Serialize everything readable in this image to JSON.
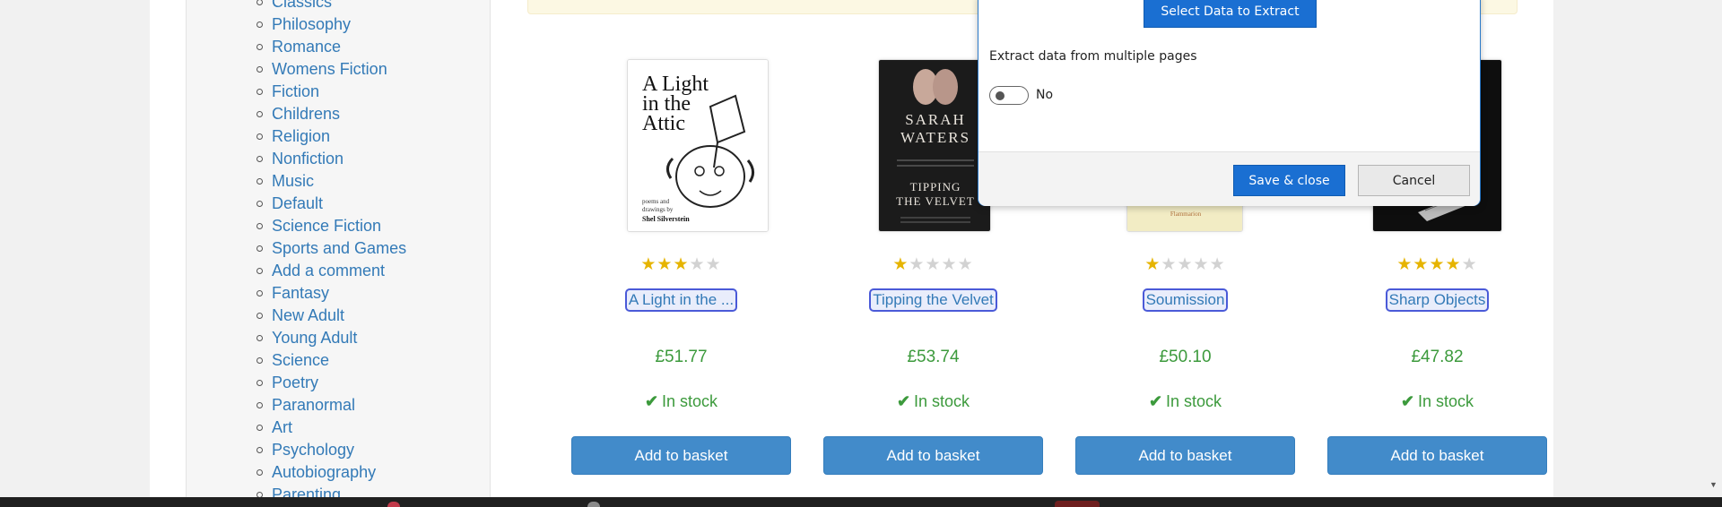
{
  "sidebar": {
    "categories": [
      "Classics",
      "Philosophy",
      "Romance",
      "Womens Fiction",
      "Fiction",
      "Childrens",
      "Religion",
      "Nonfiction",
      "Music",
      "Default",
      "Science Fiction",
      "Sports and Games",
      "Add a comment",
      "Fantasy",
      "New Adult",
      "Young Adult",
      "Science",
      "Poetry",
      "Paranormal",
      "Art",
      "Psychology",
      "Autobiography",
      "Parenting"
    ]
  },
  "products": [
    {
      "title": "A Light in the ...",
      "price": "£51.77",
      "stock": "In stock",
      "button": "Add to basket",
      "rating": 3,
      "cover": {
        "title_lines": [
          "A Light",
          "in the",
          "Attic"
        ],
        "small": [
          "poems and",
          "drawings by"
        ],
        "author": "Shel Silverstein"
      }
    },
    {
      "title": "Tipping the Velvet",
      "price": "£53.74",
      "stock": "In stock",
      "button": "Add to basket",
      "rating": 1,
      "cover": {
        "author_lines": [
          "SARAH",
          "WATERS"
        ],
        "title_lines": [
          "TIPPING",
          "THE VELVET"
        ]
      }
    },
    {
      "title": "Soumission",
      "price": "£50.10",
      "stock": "In stock",
      "button": "Add to basket",
      "rating": 1,
      "cover": {
        "small": "Flammarion"
      }
    },
    {
      "title": "Sharp Objects",
      "price": "£47.82",
      "stock": "In stock",
      "button": "Add to basket",
      "rating": 4
    }
  ],
  "check_icon": "✔",
  "star_icon": "★",
  "modal": {
    "select_button": "Select Data to Extract",
    "extract_label": "Extract data from multiple pages",
    "toggle_text": "No",
    "toggle_on": false,
    "save_button": "Save & close",
    "cancel_button": "Cancel"
  },
  "colors": {
    "link": "#337ab7",
    "price_green": "#3c9a3c",
    "basket_blue": "#428bca",
    "modal_blue": "#1a6fd2",
    "star_on": "#e6b400"
  }
}
